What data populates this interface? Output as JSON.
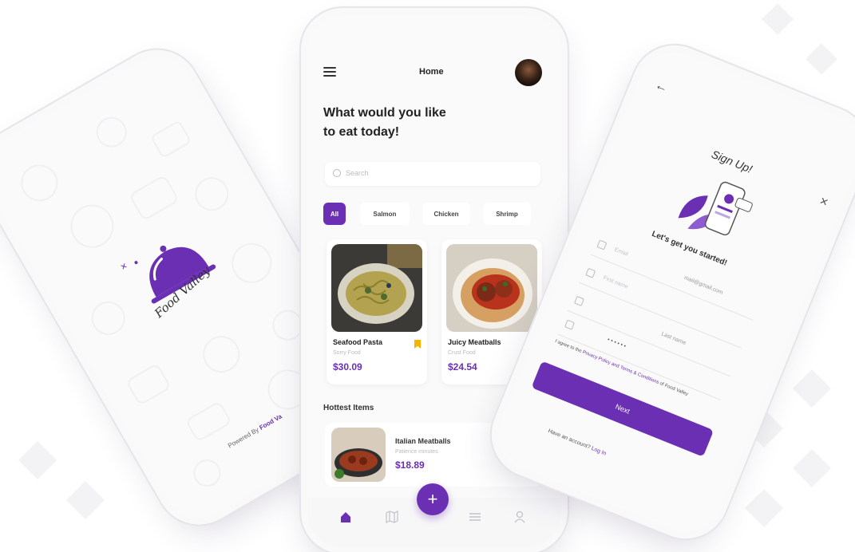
{
  "colors": {
    "accent": "#6b2fb3",
    "bookmark": "#f5b400"
  },
  "left_phone": {
    "brand": "Food Valley",
    "powered_prefix": "Powered By",
    "powered_brand": "Food Va"
  },
  "center_phone": {
    "header_title": "Home",
    "headline_line1": "What would you like",
    "headline_line2": "to eat today!",
    "search_placeholder": "Search",
    "chips": [
      "All",
      "Salmon",
      "Chicken",
      "Shrimp"
    ],
    "cards": [
      {
        "name": "Seafood Pasta",
        "subtitle": "Sorry Food",
        "price": "$30.09"
      },
      {
        "name": "Juicy Meatballs",
        "subtitle": "Crust Food",
        "price": "$24.54"
      }
    ],
    "section_title": "Hottest Items",
    "hot_item": {
      "name": "Italian Meatballs",
      "subtitle": "Patience minutes",
      "price": "$18.89"
    },
    "fab_label": "+"
  },
  "right_phone": {
    "title": "Sign Up!",
    "subtitle": "Let's get you started!",
    "email_label": "Email",
    "email_value": "mail@gmail.com",
    "first_name_label": "First name",
    "last_name_label": "Last name",
    "password_mask": "• • • • • •",
    "agree_prefix": "I agree to the",
    "agree_link": "Privacy Policy and Terms & Conditions",
    "agree_suffix": "of Food Valley",
    "next_label": "Next",
    "login_prefix": "Have an account?",
    "login_link": "Log In"
  }
}
